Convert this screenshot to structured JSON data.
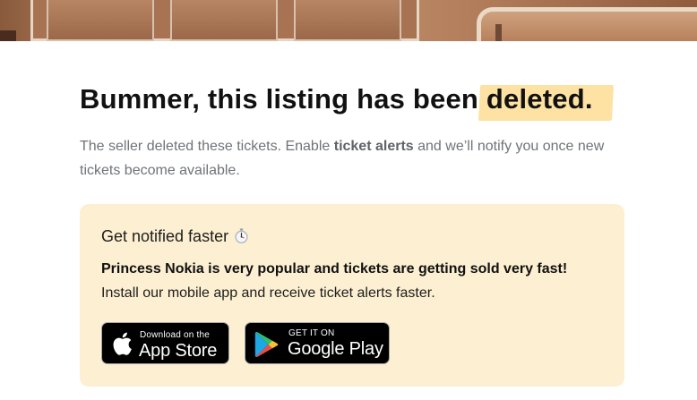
{
  "headline": {
    "prefix": "Bummer, this listing has been",
    "highlighted": "deleted."
  },
  "subtitle": {
    "before": "The seller deleted these tickets. Enable",
    "link": "ticket alerts",
    "after": "and we’ll notify you once new tickets become available."
  },
  "notify_card": {
    "title": "Get notified faster",
    "title_icon": "stopwatch-icon",
    "bold_text": "Princess Nokia is very popular and tickets are getting sold very fast!",
    "text": "Install our mobile app and receive ticket alerts faster."
  },
  "app_store": {
    "small": "Download on the",
    "big": "App Store",
    "icon": "apple-icon"
  },
  "google_play": {
    "small": "GET IT ON",
    "big": "Google Play",
    "icon": "google-play-icon"
  },
  "colors": {
    "highlight": "#fde2a3",
    "card_background": "#fdf0d2",
    "button_background": "#000000"
  }
}
